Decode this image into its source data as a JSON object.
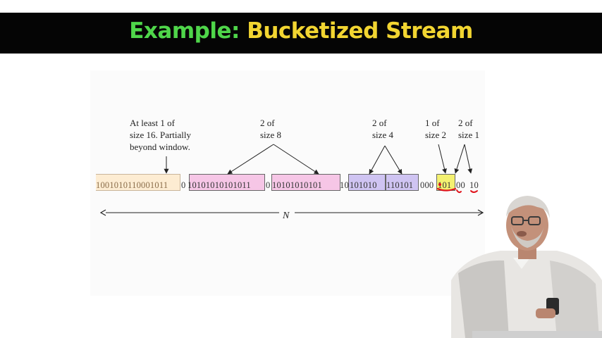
{
  "title": {
    "part1": "Example:",
    "part2": "Bucketized Stream"
  },
  "annotations": {
    "size16": "At least 1 of\nsize 16.  Partially\nbeyond window.",
    "size8": "2 of\nsize 8",
    "size4": "2 of\nsize 4",
    "size2": "1 of\nsize 2",
    "size1": "2 of\nsize 1"
  },
  "bits": {
    "b16": "1001010110001011",
    "g1": "0",
    "b8a": "10101010101011",
    "g2": "0",
    "b8b": "10101010101",
    "g3": "10",
    "b4a": "101010",
    "b4b": "110101",
    "g4": "000",
    "b2": "101",
    "g5": "00",
    "b1": "10"
  },
  "window_label": "N",
  "colors": {
    "bucket16": "#fdecd2",
    "bucket8": "#f6c6e6",
    "bucket4": "#cfc4f2",
    "bucket2": "#f4f171",
    "title_green": "#4fd64a",
    "title_yellow": "#f2d531",
    "pen_mark": "#e0141c"
  }
}
